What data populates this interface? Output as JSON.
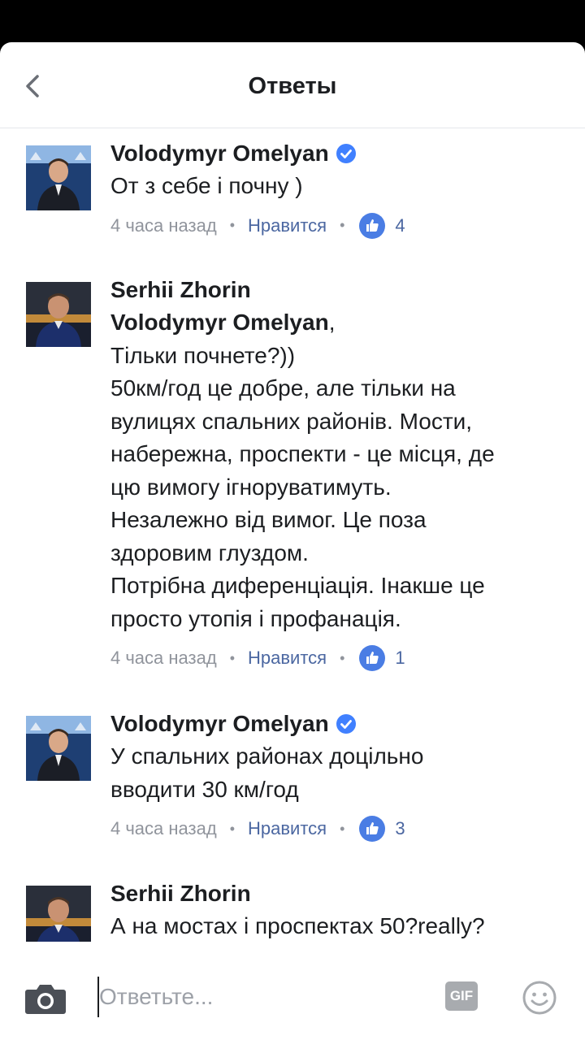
{
  "header": {
    "title": "Ответы"
  },
  "comments": [
    {
      "author": "Volodymyr Omelyan",
      "verified": true,
      "mention": "",
      "lines": [
        "От з себе і почну )"
      ],
      "time": "4 часа назад",
      "like_label": "Нравится",
      "like_count": "4"
    },
    {
      "author": "Serhii Zhorin",
      "verified": false,
      "mention": "Volodymyr Omelyan",
      "mention_suffix": ",",
      "lines": [
        "Тільки почнете?))",
        "50км/год це добре, але тільки на",
        "вулицях спальних районів. Мости,",
        "набережна, проспекти - це місця,  де",
        "цю вимогу ігноруватимуть.",
        "Незалежно від вимог. Це поза",
        "здоровим глуздом.",
        "Потрібна диференціація. Інакше це",
        "просто утопія і профанація."
      ],
      "time": "4 часа назад",
      "like_label": "Нравится",
      "like_count": "1"
    },
    {
      "author": "Volodymyr Omelyan",
      "verified": true,
      "mention": "",
      "lines": [
        "У спальних районах доцільно",
        "вводити 30 км/год"
      ],
      "time": "4 часа назад",
      "like_label": "Нравится",
      "like_count": "3"
    },
    {
      "author": "Serhii Zhorin",
      "verified": false,
      "mention": "",
      "lines": [
        "А на мостах і проспектах 50?really?"
      ]
    }
  ],
  "composer": {
    "placeholder": "Ответьте...",
    "gif_label": "GIF"
  },
  "colors": {
    "accent": "#4b67a1",
    "like_blue": "#4a7de4",
    "verified_blue": "#4080ff",
    "meta_gray": "#90949c"
  },
  "icons": [
    "back-arrow-icon",
    "verified-badge-icon",
    "thumbs-up-icon",
    "camera-icon",
    "gif-icon",
    "emoji-icon"
  ]
}
